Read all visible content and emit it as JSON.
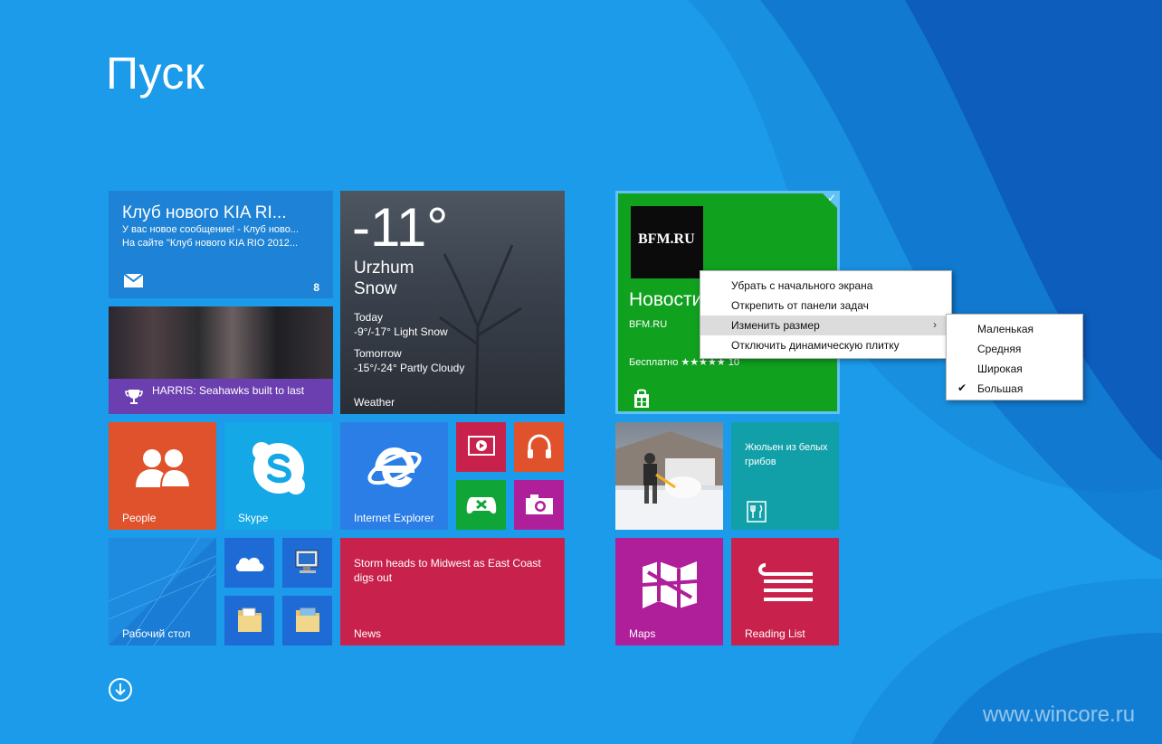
{
  "start": {
    "title": "Пуск"
  },
  "colors": {
    "background": "#1b9bea",
    "bfm_tile": "#10a11f",
    "selection": "#62c1f5"
  },
  "tiles": {
    "mail": {
      "header": "Клуб нового KIA RI...",
      "line1": "У вас новое сообщение! - Клуб ново...",
      "line2": "На сайте \"Клуб нового KIA RIO 2012...",
      "count": "8",
      "icon": "mail-icon"
    },
    "sport": {
      "caption": "HARRIS: Seahawks built to last",
      "icon": "trophy-icon"
    },
    "weather": {
      "temperature": "-11°",
      "city": "Urzhum",
      "condition": "Snow",
      "today_label": "Today",
      "today_forecast": "-9°/-17° Light Snow",
      "tomorrow_label": "Tomorrow",
      "tomorrow_forecast": "-15°/-24° Partly Cloudy",
      "label": "Weather"
    },
    "people": {
      "label": "People",
      "icon": "people-icon"
    },
    "skype": {
      "label": "Skype",
      "icon": "skype-icon"
    },
    "ie": {
      "label": "Internet Explorer",
      "icon": "ie-icon"
    },
    "video": {
      "icon": "video-icon"
    },
    "music": {
      "icon": "headphones-icon"
    },
    "games": {
      "icon": "xbox-icon"
    },
    "camera": {
      "icon": "camera-icon"
    },
    "desktop": {
      "label": "Рабочий стол"
    },
    "onedrive": {
      "icon": "cloud-icon"
    },
    "pc": {
      "icon": "computer-icon"
    },
    "docs": {
      "icon": "folder-documents-icon"
    },
    "pics": {
      "icon": "folder-pictures-icon"
    },
    "news": {
      "headline": "Storm heads to Midwest as East Coast digs out",
      "label": "News"
    },
    "bfm": {
      "logo_text": "BFM.RU",
      "title": "Новости",
      "publisher": "BFM.RU",
      "rating": "Бесплатно ★★★★★ 10",
      "icon": "store-icon"
    },
    "recipe": {
      "text": "Жюльен из белых грибов",
      "icon": "fork-knife-icon"
    },
    "maps": {
      "label": "Maps",
      "icon": "maps-icon"
    },
    "reading": {
      "label": "Reading List",
      "icon": "reading-list-icon"
    }
  },
  "context_menu": {
    "items": [
      "Убрать с начального экрана",
      "Открепить от панели задач",
      "Изменить размер",
      "Отключить динамическую плитку"
    ],
    "highlighted": "Изменить размер",
    "arrow": "›"
  },
  "submenu": {
    "items": [
      "Маленькая",
      "Средняя",
      "Широкая",
      "Большая"
    ],
    "checked": "Большая",
    "check_glyph": "✔"
  },
  "watermark": "www.wincore.ru"
}
